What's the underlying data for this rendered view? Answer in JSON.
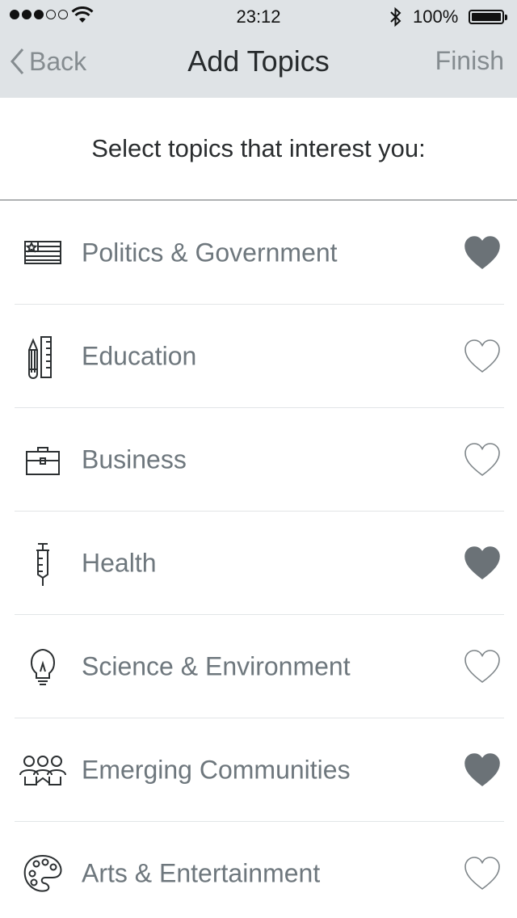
{
  "status_bar": {
    "signal_filled": 3,
    "signal_total": 5,
    "time": "23:12",
    "battery_text": "100%",
    "battery_level": 1.0
  },
  "nav": {
    "back_label": "Back",
    "title": "Add Topics",
    "finish_label": "Finish"
  },
  "prompt": "Select topics that interest you:",
  "colors": {
    "nav_background": "#dfe3e6",
    "heart_fill": "#6b7277",
    "text": "#6e777d"
  },
  "topics": [
    {
      "label": "Politics & Government",
      "icon": "flag-icon",
      "favorited": true
    },
    {
      "label": "Education",
      "icon": "pencil-ruler-icon",
      "favorited": false
    },
    {
      "label": "Business",
      "icon": "briefcase-icon",
      "favorited": false
    },
    {
      "label": "Health",
      "icon": "syringe-icon",
      "favorited": true
    },
    {
      "label": "Science & Environment",
      "icon": "lightbulb-icon",
      "favorited": false
    },
    {
      "label": "Emerging Communities",
      "icon": "people-group-icon",
      "favorited": true
    },
    {
      "label": "Arts & Entertainment",
      "icon": "palette-icon",
      "favorited": false
    }
  ]
}
